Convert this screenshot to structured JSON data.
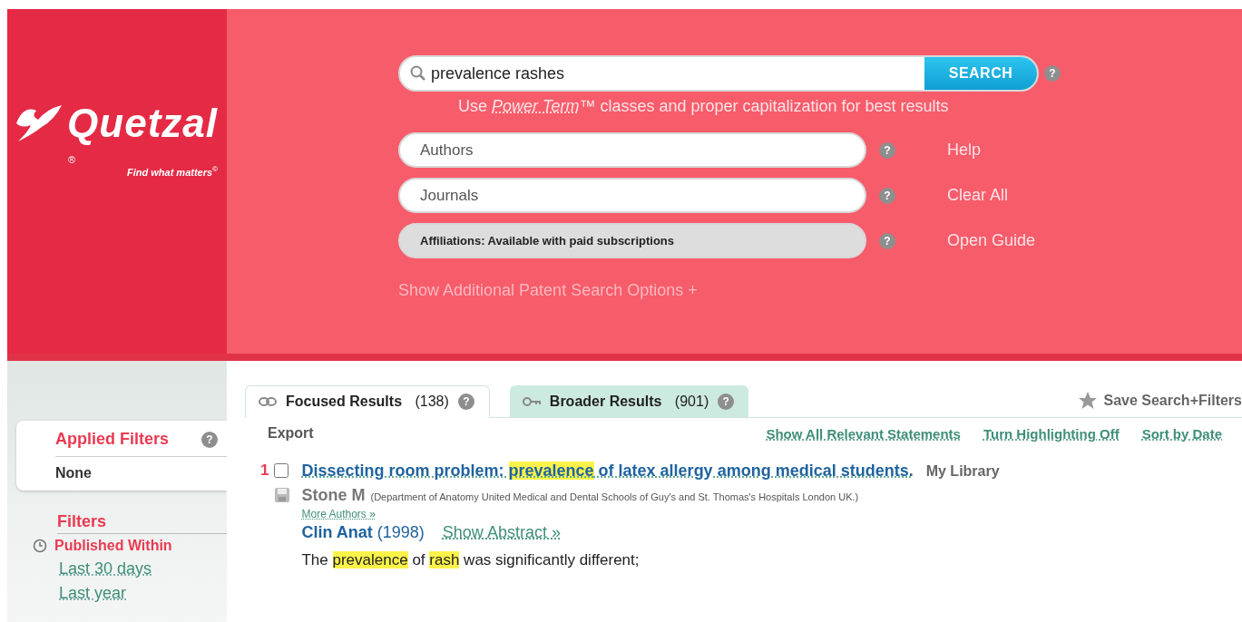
{
  "logo": {
    "name": "Quetzal",
    "registered": "®",
    "tagline": "Find what matters$^{©}$"
  },
  "search": {
    "value": "prevalence rashes",
    "button": "SEARCH",
    "help": "?",
    "hint_prefix": "Use",
    "hint_link": "Power Term",
    "hint_suffix": "™ classes and proper capitalization for best results"
  },
  "fields": [
    {
      "placeholder": "Authors",
      "disabled": false,
      "help": "?"
    },
    {
      "placeholder": "Journals",
      "disabled": false,
      "help": "?"
    },
    {
      "placeholder": "Affiliations: Available with paid subscriptions",
      "disabled": true,
      "help": "?"
    }
  ],
  "side_links": [
    "Help",
    "Clear All",
    "Open Guide"
  ],
  "more_options": "Show Additional Patent Search Options +",
  "sidebar": {
    "applied_title": "Applied Filters",
    "applied_help": "?",
    "applied_value": "None",
    "filters_title": "Filters",
    "group": "Published Within",
    "options": [
      "Last 30 days",
      "Last year"
    ]
  },
  "tabs": [
    {
      "label": "Focused Results",
      "count": "(138)",
      "selected": true,
      "help": "?"
    },
    {
      "label": "Broader Results",
      "count": "(901)",
      "selected": false,
      "help": "?"
    }
  ],
  "save_search": "Save Search+Filters",
  "toolbar": {
    "export": "Export",
    "actions": [
      "Show All Relevant Statements",
      "Turn Highlighting Off",
      "Sort by Date"
    ]
  },
  "results": [
    {
      "number": "1",
      "checked": false,
      "title": [
        {
          "text": "Dissecting room problem: ",
          "highlighted": false
        },
        {
          "text": "prevalence",
          "highlighted": true
        },
        {
          "text": " of latex allergy among medical students.",
          "highlighted": false
        }
      ],
      "library": "My Library",
      "author": "Stone M",
      "affiliation": "(Department of Anatomy United Medical and Dental Schools of Guy's and St. Thomas's Hospitals London UK.)",
      "more_authors": "More Authors »",
      "journal": "Clin Anat",
      "year": "(1998)",
      "abstract_link": "Show Abstract »",
      "snippet": [
        {
          "text": "The ",
          "highlighted": false
        },
        {
          "text": "prevalence",
          "highlighted": true
        },
        {
          "text": " of ",
          "highlighted": false
        },
        {
          "text": "rash",
          "highlighted": true
        },
        {
          "text": " was significantly different;",
          "highlighted": false
        }
      ]
    }
  ]
}
